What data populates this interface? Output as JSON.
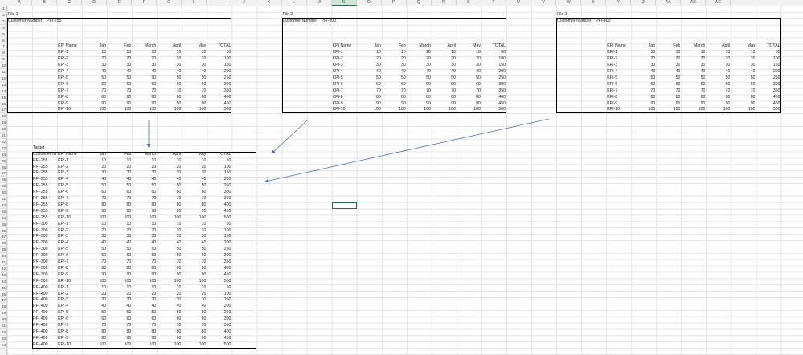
{
  "columns": [
    "A",
    "B",
    "C",
    "D",
    "E",
    "F",
    "G",
    "H",
    "I",
    "J",
    "K",
    "L",
    "M",
    "N",
    "O",
    "P",
    "Q",
    "R",
    "S",
    "T",
    "U",
    "V",
    "W",
    "X",
    "Y",
    "Z",
    "AA",
    "AB",
    "AC"
  ],
  "selected_column": "N",
  "row_count": 54,
  "files": [
    {
      "title": "File 1",
      "customer_label": "Customer Number",
      "customer_value": "PFI-255",
      "headers": [
        "KPI Name",
        "Jan",
        "Feb",
        "March",
        "April",
        "May",
        "TOTAL"
      ],
      "rows": [
        [
          "KPI-1",
          10,
          10,
          10,
          10,
          10,
          50
        ],
        [
          "KPI-2",
          20,
          20,
          20,
          20,
          20,
          100
        ],
        [
          "KPI-3",
          30,
          30,
          30,
          30,
          30,
          150
        ],
        [
          "KPI-4",
          40,
          40,
          40,
          40,
          40,
          200
        ],
        [
          "KPI-5",
          50,
          50,
          50,
          50,
          50,
          250
        ],
        [
          "KPI-6",
          60,
          60,
          60,
          60,
          60,
          300
        ],
        [
          "KPI-7",
          70,
          70,
          70,
          70,
          70,
          350
        ],
        [
          "KPI-8",
          80,
          80,
          80,
          80,
          80,
          400
        ],
        [
          "KPI-9",
          90,
          90,
          90,
          90,
          90,
          450
        ],
        [
          "KPI-10",
          100,
          100,
          100,
          100,
          100,
          500
        ]
      ]
    },
    {
      "title": "File 2",
      "customer_label": "Customer Number",
      "customer_value": "PFI-300",
      "headers": [
        "KPI Name",
        "Jan",
        "Feb",
        "March",
        "April",
        "May",
        "TOTAL"
      ],
      "rows": [
        [
          "KPI-1",
          10,
          10,
          10,
          10,
          10,
          50
        ],
        [
          "KPI-2",
          20,
          20,
          20,
          20,
          20,
          100
        ],
        [
          "KPI-3",
          30,
          30,
          30,
          30,
          30,
          150
        ],
        [
          "KPI-4",
          40,
          40,
          40,
          40,
          40,
          200
        ],
        [
          "KPI-5",
          50,
          50,
          50,
          50,
          50,
          250
        ],
        [
          "KPI-6",
          60,
          60,
          60,
          60,
          60,
          300
        ],
        [
          "KPI-7",
          70,
          70,
          70,
          70,
          70,
          350
        ],
        [
          "KPI-8",
          80,
          80,
          80,
          80,
          80,
          400
        ],
        [
          "KPI-9",
          90,
          90,
          90,
          90,
          90,
          450
        ],
        [
          "KPI-10",
          100,
          100,
          100,
          100,
          100,
          500
        ]
      ]
    },
    {
      "title": "File 3",
      "customer_label": "Customer Number",
      "customer_value": "PFI-400",
      "headers": [
        "KPI Name",
        "Jan",
        "Feb",
        "March",
        "April",
        "May",
        "TOTAL"
      ],
      "rows": [
        [
          "KPI-1",
          10,
          10,
          10,
          10,
          10,
          50
        ],
        [
          "KPI-2",
          20,
          20,
          20,
          20,
          20,
          100
        ],
        [
          "KPI-3",
          30,
          30,
          30,
          30,
          30,
          150
        ],
        [
          "KPI-4",
          40,
          40,
          40,
          40,
          40,
          200
        ],
        [
          "KPI-5",
          50,
          50,
          50,
          50,
          50,
          250
        ],
        [
          "KPI-6",
          60,
          60,
          60,
          60,
          60,
          300
        ],
        [
          "KPI-7",
          70,
          70,
          70,
          70,
          70,
          350
        ],
        [
          "KPI-8",
          80,
          80,
          80,
          80,
          80,
          400
        ],
        [
          "KPI-9",
          90,
          90,
          90,
          90,
          90,
          450
        ],
        [
          "KPI-10",
          100,
          100,
          100,
          100,
          100,
          500
        ]
      ]
    }
  ],
  "target": {
    "title": "Target",
    "headers": [
      "Customer Number",
      "KPI Name",
      "Jan",
      "Feb",
      "March",
      "April",
      "May",
      "TOTAL"
    ],
    "rows": [
      [
        "PFI-255",
        "KPI-1",
        10,
        10,
        10,
        10,
        10,
        50
      ],
      [
        "PFI-255",
        "KPI-2",
        20,
        20,
        20,
        20,
        20,
        100
      ],
      [
        "PFI-255",
        "KPI-3",
        30,
        30,
        30,
        30,
        30,
        150
      ],
      [
        "PFI-255",
        "KPI-4",
        40,
        40,
        40,
        40,
        40,
        200
      ],
      [
        "PFI-255",
        "KPI-5",
        50,
        50,
        50,
        50,
        50,
        250
      ],
      [
        "PFI-255",
        "KPI-6",
        60,
        60,
        60,
        60,
        60,
        300
      ],
      [
        "PFI-255",
        "KPI-7",
        70,
        70,
        70,
        70,
        70,
        350
      ],
      [
        "PFI-255",
        "KPI-8",
        80,
        80,
        80,
        80,
        80,
        400
      ],
      [
        "PFI-255",
        "KPI-9",
        90,
        90,
        90,
        90,
        90,
        450
      ],
      [
        "PFI-255",
        "KPI-10",
        100,
        100,
        100,
        100,
        100,
        500
      ],
      [
        "PFI-300",
        "KPI-1",
        10,
        10,
        10,
        10,
        10,
        50
      ],
      [
        "PFI-300",
        "KPI-2",
        20,
        20,
        20,
        20,
        20,
        100
      ],
      [
        "PFI-300",
        "KPI-3",
        30,
        30,
        30,
        30,
        30,
        150
      ],
      [
        "PFI-300",
        "KPI-4",
        40,
        40,
        40,
        40,
        40,
        200
      ],
      [
        "PFI-300",
        "KPI-5",
        50,
        50,
        50,
        50,
        50,
        250
      ],
      [
        "PFI-300",
        "KPI-6",
        60,
        60,
        60,
        60,
        60,
        300
      ],
      [
        "PFI-300",
        "KPI-7",
        70,
        70,
        70,
        70,
        70,
        350
      ],
      [
        "PFI-300",
        "KPI-8",
        80,
        80,
        80,
        80,
        80,
        400
      ],
      [
        "PFI-300",
        "KPI-9",
        90,
        90,
        90,
        90,
        90,
        450
      ],
      [
        "PFI-300",
        "KPI-10",
        100,
        100,
        100,
        100,
        100,
        500
      ],
      [
        "PFI-400",
        "KPI-1",
        10,
        10,
        10,
        10,
        10,
        50
      ],
      [
        "PFI-400",
        "KPI-2",
        20,
        20,
        20,
        20,
        20,
        100
      ],
      [
        "PFI-400",
        "KPI-3",
        30,
        30,
        30,
        30,
        30,
        150
      ],
      [
        "PFI-400",
        "KPI-4",
        40,
        40,
        40,
        40,
        40,
        200
      ],
      [
        "PFI-400",
        "KPI-5",
        50,
        50,
        50,
        50,
        50,
        250
      ],
      [
        "PFI-400",
        "KPI-6",
        60,
        60,
        60,
        60,
        60,
        300
      ],
      [
        "PFI-400",
        "KPI-7",
        70,
        70,
        70,
        70,
        70,
        350
      ],
      [
        "PFI-400",
        "KPI-8",
        80,
        80,
        80,
        80,
        80,
        400
      ],
      [
        "PFI-400",
        "KPI-9",
        90,
        90,
        90,
        90,
        90,
        450
      ],
      [
        "PFI-400",
        "KPI-10",
        100,
        100,
        100,
        100,
        100,
        500
      ]
    ]
  },
  "colors": {
    "arrow": "#4472c4",
    "selection": "#217346",
    "border": "#000000"
  }
}
